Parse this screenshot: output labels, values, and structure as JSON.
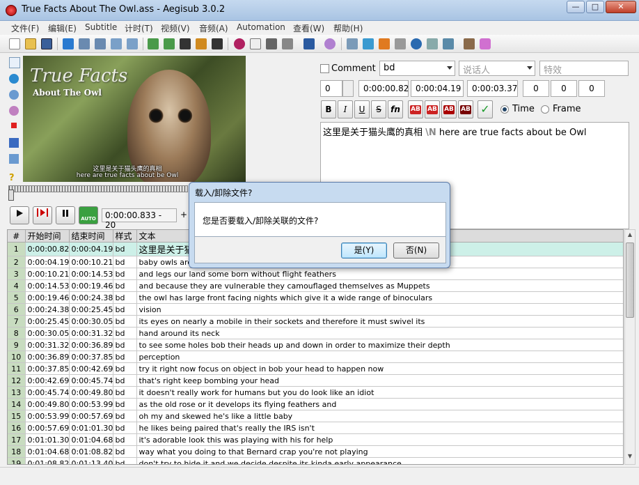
{
  "window": {
    "title": "True Facts About The Owl.ass - Aegisub 3.0.2",
    "min_glyph": "—",
    "max_glyph": "□",
    "close_glyph": "✕"
  },
  "menu": [
    "文件(F)",
    "编辑(E)",
    "Subtitle",
    "计时(T)",
    "视频(V)",
    "音频(A)",
    "Automation",
    "查看(W)",
    "帮助(H)"
  ],
  "video": {
    "overlay_title": "True Facts",
    "overlay_subtitle": "About The Owl",
    "sub_line1": "这里是关于猫头鹰的真相",
    "sub_line2": "here are true facts about be Owl"
  },
  "playback": {
    "time_display": "0:00:00.833 - 20",
    "plus": "+",
    "auto_label": "AUTO"
  },
  "edit": {
    "comment_label": "Comment",
    "style_value": "bd",
    "actor_placeholder": "说话人",
    "effect_placeholder": "特效",
    "layer": "0",
    "start_time": "0:00:00.82",
    "end_time": "0:00:04.19",
    "duration": "0:00:03.37",
    "margin_l": "0",
    "margin_r": "0",
    "margin_v": "0",
    "bold": "B",
    "italic": "I",
    "underline": "U",
    "strike": "S",
    "font": "fn",
    "color_labels": [
      "AB",
      "AB",
      "AB",
      "AB"
    ],
    "commit": "✓",
    "time_label": "Time",
    "frame_label": "Frame",
    "text_cn": "这里是关于猫头鹰的真相 ",
    "text_escape": "\\N",
    "text_en": " here are true facts about be Owl"
  },
  "grid": {
    "headers": [
      "#",
      "开始时间",
      "结束时间",
      "样式",
      "文本"
    ],
    "rows": [
      {
        "n": "1",
        "start": "0:00:00.82",
        "end": "0:00:04.19",
        "style": "bd",
        "text": "这里是关于猫"
      },
      {
        "n": "2",
        "start": "0:00:04.19",
        "end": "0:00:10.21",
        "style": "bd",
        "text": "baby owls are"
      },
      {
        "n": "3",
        "start": "0:00:10.21",
        "end": "0:00:14.53",
        "style": "bd",
        "text": "and legs our land some born without flight feathers"
      },
      {
        "n": "4",
        "start": "0:00:14.53",
        "end": "0:00:19.46",
        "style": "bd",
        "text": "and because they are vulnerable they camouflaged themselves as Muppets"
      },
      {
        "n": "5",
        "start": "0:00:19.46",
        "end": "0:00:24.38",
        "style": "bd",
        "text": "the owl has large front facing nights which give it a wide range of binoculars"
      },
      {
        "n": "6",
        "start": "0:00:24.38",
        "end": "0:00:25.45",
        "style": "bd",
        "text": "vision"
      },
      {
        "n": "7",
        "start": "0:00:25.45",
        "end": "0:00:30.05",
        "style": "bd",
        "text": "its eyes on nearly a mobile in their sockets and therefore it must swivel its"
      },
      {
        "n": "8",
        "start": "0:00:30.05",
        "end": "0:00:31.32",
        "style": "bd",
        "text": "hand around its neck"
      },
      {
        "n": "9",
        "start": "0:00:31.32",
        "end": "0:00:36.89",
        "style": "bd",
        "text": "to see some holes bob their heads up and down in order to maximize their depth"
      },
      {
        "n": "10",
        "start": "0:00:36.89",
        "end": "0:00:37.85",
        "style": "bd",
        "text": "perception"
      },
      {
        "n": "11",
        "start": "0:00:37.85",
        "end": "0:00:42.69",
        "style": "bd",
        "text": "try it right now focus on object in bob your head to happen now"
      },
      {
        "n": "12",
        "start": "0:00:42.69",
        "end": "0:00:45.74",
        "style": "bd",
        "text": "that's right keep bombing your head"
      },
      {
        "n": "13",
        "start": "0:00:45.74",
        "end": "0:00:49.80",
        "style": "bd",
        "text": "it doesn't really work for humans but you do look like an idiot"
      },
      {
        "n": "14",
        "start": "0:00:49.80",
        "end": "0:00:53.99",
        "style": "bd",
        "text": "as the old rose or it develops its flying feathers and"
      },
      {
        "n": "15",
        "start": "0:00:53.99",
        "end": "0:00:57.69",
        "style": "bd",
        "text": "oh my and skewed he's like a little baby"
      },
      {
        "n": "16",
        "start": "0:00:57.69",
        "end": "0:01:01.30",
        "style": "bd",
        "text": "he likes being paired that's really the IRS isn't"
      },
      {
        "n": "17",
        "start": "0:01:01.30",
        "end": "0:01:04.68",
        "style": "bd",
        "text": "it's adorable look this was playing with his for help"
      },
      {
        "n": "18",
        "start": "0:01:04.68",
        "end": "0:01:08.82",
        "style": "bd",
        "text": "way what you doing to that Bernard crap you're not playing"
      },
      {
        "n": "19",
        "start": "0:01:08.82",
        "end": "0:01:13.40",
        "style": "bd",
        "text": "don't try to hide it and we decide despite its kinda early appearance"
      }
    ]
  },
  "dialog": {
    "title": "载入/卸除文件?",
    "message": "您是否要载入/卸除关联的文件?",
    "yes": "是(Y)",
    "no": "否(N)"
  },
  "colors": {
    "selected_row": "#cdf0e8",
    "row_number": "#c8dcc0",
    "dialog_frame": "#c7dbf0"
  }
}
